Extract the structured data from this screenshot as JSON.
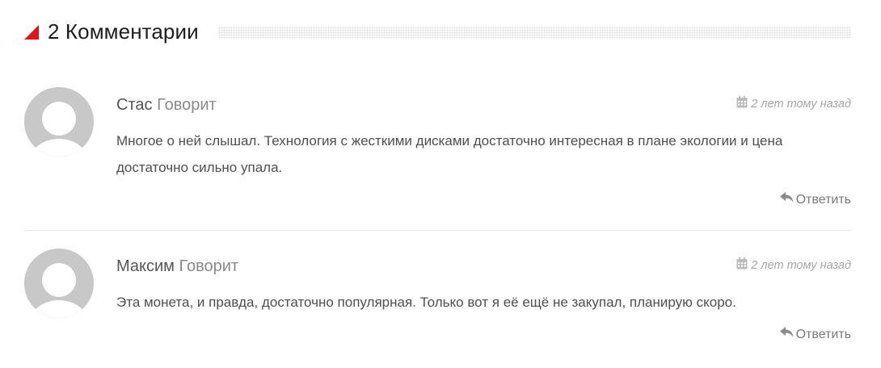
{
  "comments_section": {
    "title": "2 Комментарии",
    "accent_color": "#e3121b",
    "icons": {
      "title": "red-triangle-icon",
      "date": "calendar-icon",
      "reply": "reply-arrow-icon",
      "avatar": "default-user-avatar-icon"
    },
    "comments": [
      {
        "author": "Стас",
        "says": "Говорит",
        "date": "2 лет тому назад",
        "text": "Многое о ней слышал. Технология с жесткими дисками достаточно интересная в плане экологии и цена достаточно сильно упала.",
        "reply_label": "Ответить"
      },
      {
        "author": "Максим",
        "says": "Говорит",
        "date": "2 лет тому назад",
        "text": "Эта монета, и правда, достаточно популярная. Только вот я её ещё не закупал, планирую скоро.",
        "reply_label": "Ответить"
      }
    ]
  }
}
